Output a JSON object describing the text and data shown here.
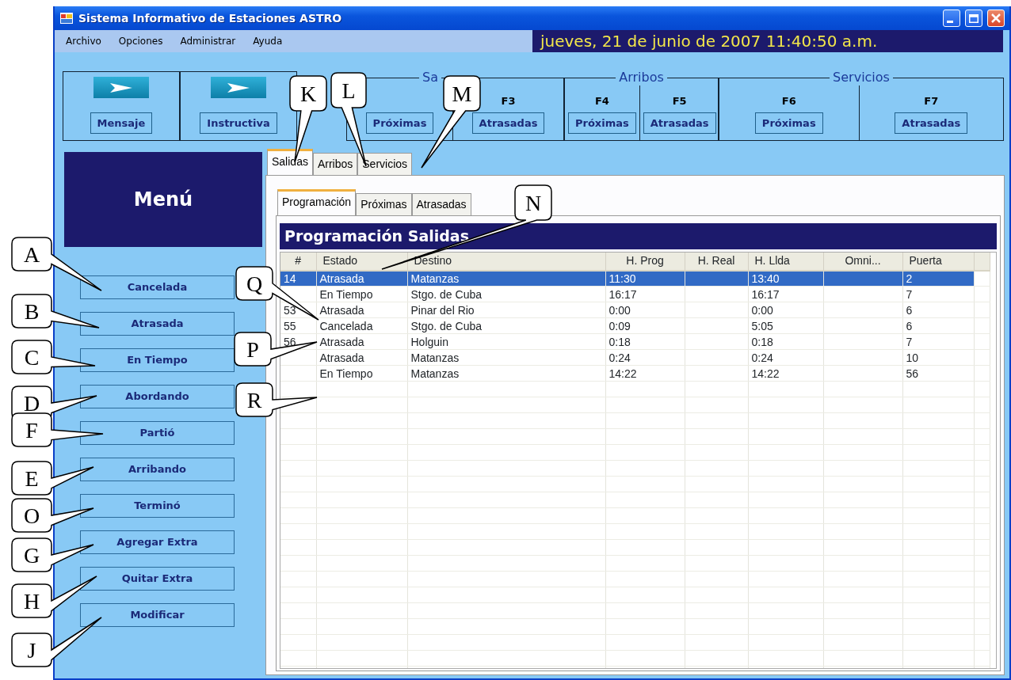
{
  "window": {
    "title": "Sistema Informativo de Estaciones ASTRO"
  },
  "menu": [
    "Archivo",
    "Opciones",
    "Administrar",
    "Ayuda"
  ],
  "datetime": "jueves, 21 de junio de 2007 11:40:50 a.m.",
  "quick_buttons": [
    {
      "label": "Mensaje"
    },
    {
      "label": "Instructiva"
    }
  ],
  "key_groups": [
    {
      "legend": "Sa",
      "keys": [
        {
          "label": "Próximas"
        },
        {
          "key": "F3",
          "label": "Atrasadas"
        }
      ]
    },
    {
      "legend": "Arribos",
      "keys": [
        {
          "key": "F4",
          "label": "Próximas"
        },
        {
          "key": "F5",
          "label": "Atrasadas"
        }
      ]
    },
    {
      "legend": "Servicios",
      "keys": [
        {
          "key": "F6",
          "label": "Próximas"
        },
        {
          "key": "F7",
          "label": "Atrasadas"
        }
      ]
    }
  ],
  "sidebar": {
    "title": "Menú",
    "buttons": [
      "Cancelada",
      "Atrasada",
      "En Tiempo",
      "Abordando",
      "Partió",
      "Arribando",
      "Terminó",
      "Agregar Extra",
      "Quitar Extra",
      "Modificar"
    ]
  },
  "tabs": [
    {
      "label": "Salidas",
      "selected": true
    },
    {
      "label": "Arribos",
      "selected": false
    },
    {
      "label": "Servicios",
      "selected": false
    }
  ],
  "subtabs": [
    {
      "label": "Programación",
      "selected": true
    },
    {
      "label": "Próximas",
      "selected": false
    },
    {
      "label": "Atrasadas",
      "selected": false
    }
  ],
  "grid": {
    "title": "Programación Salidas",
    "columns": [
      "#",
      "Estado",
      "Destino",
      "H. Prog",
      "H. Real",
      "H. Llda",
      "Omni...",
      "Puerta"
    ],
    "rows": [
      {
        "selected": true,
        "cells": [
          "14",
          "Atrasada",
          "Matanzas",
          "11:30",
          null,
          "13:40",
          null,
          "2"
        ]
      },
      {
        "selected": false,
        "cells": [
          null,
          "En Tiempo",
          "Stgo. de Cuba",
          "16:17",
          null,
          "16:17",
          null,
          "7"
        ]
      },
      {
        "selected": false,
        "cells": [
          "53",
          "Atrasada",
          "Pinar del Rio",
          "0:00",
          null,
          "0:00",
          null,
          "6"
        ]
      },
      {
        "selected": false,
        "cells": [
          "55",
          "Cancelada",
          "Stgo. de Cuba",
          "0:09",
          null,
          "5:05",
          null,
          "6"
        ]
      },
      {
        "selected": false,
        "cells": [
          "56",
          "Atrasada",
          "Holguin",
          "0:18",
          null,
          "0:18",
          null,
          "7"
        ]
      },
      {
        "selected": false,
        "cells": [
          null,
          "Atrasada",
          "Matanzas",
          "0:24",
          null,
          "0:24",
          null,
          "10"
        ]
      },
      {
        "selected": false,
        "cells": [
          null,
          "En Tiempo",
          "Matanzas",
          "14:22",
          null,
          "14:22",
          null,
          "56"
        ]
      }
    ]
  },
  "callouts": [
    {
      "letter": "A"
    },
    {
      "letter": "B"
    },
    {
      "letter": "C"
    },
    {
      "letter": "D"
    },
    {
      "letter": "F"
    },
    {
      "letter": "E"
    },
    {
      "letter": "O"
    },
    {
      "letter": "G"
    },
    {
      "letter": "H"
    },
    {
      "letter": "J"
    },
    {
      "letter": "K"
    },
    {
      "letter": "L"
    },
    {
      "letter": "M"
    },
    {
      "letter": "N"
    },
    {
      "letter": "Q"
    },
    {
      "letter": "P"
    },
    {
      "letter": "R"
    }
  ]
}
